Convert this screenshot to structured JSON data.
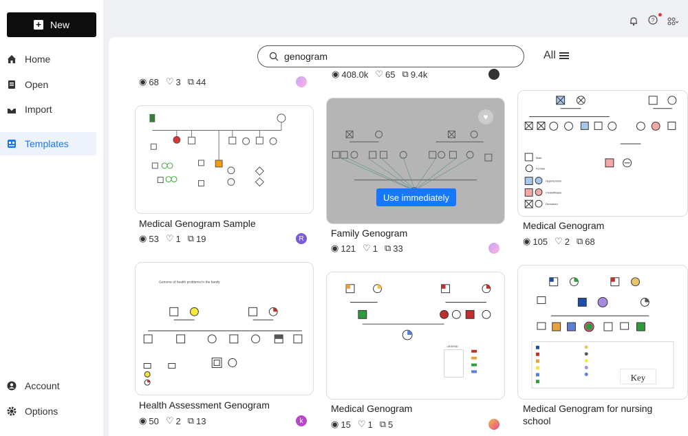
{
  "sidebar": {
    "new_label": "New",
    "items": [
      {
        "label": "Home",
        "icon": "home-icon"
      },
      {
        "label": "Open",
        "icon": "open-icon"
      },
      {
        "label": "Import",
        "icon": "import-icon"
      },
      {
        "label": "Templates",
        "icon": "templates-icon"
      },
      {
        "label": "Account",
        "icon": "account-icon"
      },
      {
        "label": "Options",
        "icon": "gear-icon"
      }
    ]
  },
  "search": {
    "value": "genogram",
    "placeholder": ""
  },
  "filter": {
    "label": "All"
  },
  "accent": "#1677ff",
  "top_partial": [
    {
      "views": "68",
      "likes": "3",
      "copies": "44"
    },
    {
      "views": "408.0k",
      "likes": "65",
      "copies": "9.4k"
    }
  ],
  "cards": [
    {
      "title": "Medical Genogram Sample",
      "views": "53",
      "likes": "1",
      "copies": "19",
      "avatar": "R"
    },
    {
      "title": "Family Genogram",
      "views": "121",
      "likes": "1",
      "copies": "33",
      "avatar": "",
      "use_label": "Use immediately"
    },
    {
      "title": "Medical Genogram",
      "views": "105",
      "likes": "2",
      "copies": "68",
      "avatar": ""
    },
    {
      "title": "Health Assessment Genogram",
      "views": "50",
      "likes": "2",
      "copies": "13",
      "avatar": "k"
    },
    {
      "title": "Medical Genogram",
      "views": "15",
      "likes": "1",
      "copies": "5",
      "avatar": ""
    },
    {
      "title": "Medical Genogram for nursing school",
      "title_line1": "Medical Genogram for nursing",
      "title_line2": "school"
    }
  ],
  "thumb_text": {
    "card3_legend": [
      "Male",
      "Female",
      "Hypertension",
      "Cholelithiasis",
      "Deceased"
    ],
    "card4_heading": "Genome of health problems in the family",
    "card5_legend_title": "LEGEND",
    "card6_key": "Key"
  }
}
